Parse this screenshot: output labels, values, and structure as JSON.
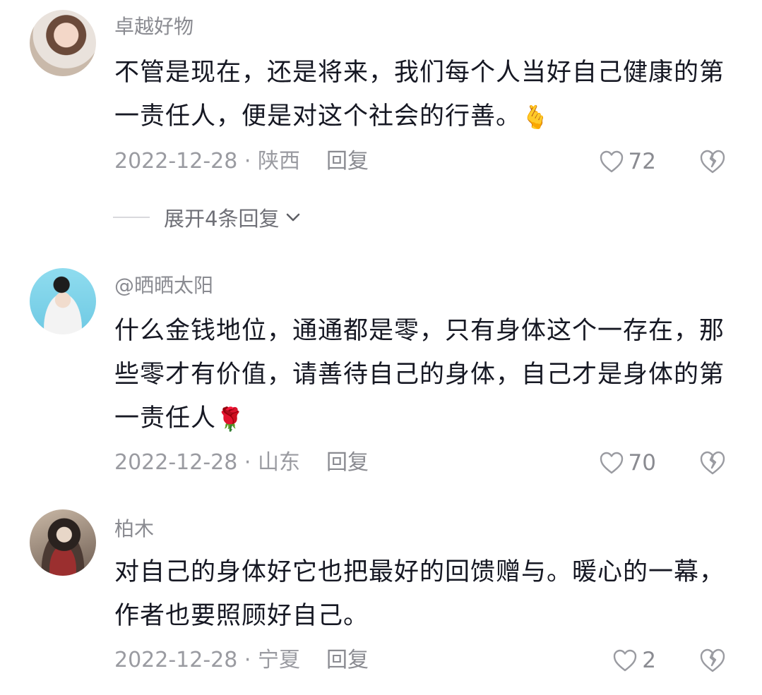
{
  "comments": [
    {
      "username": "卓越好物",
      "text": "不管是现在，还是将来，我们每个人当好自己健康的第一责任人，便是对这个社会的行善。",
      "emoji": "🫰",
      "date_location": "2022-12-28 · 陕西",
      "reply_label": "回复",
      "likes": "72",
      "expand_label": "展开4条回复"
    },
    {
      "username": "@晒晒太阳",
      "text": "什么金钱地位，通通都是零，只有身体这个一存在，那些零才有价值，请善待自己的身体，自己才是身体的第一责任人",
      "emoji": "🌹",
      "date_location": "2022-12-28 · 山东",
      "reply_label": "回复",
      "likes": "70"
    },
    {
      "username": "柏木",
      "text": "对自己的身体好它也把最好的回馈赠与。暖心的一幕，作者也要照顾好自己。",
      "date_location": "2022-12-28 · 宁夏",
      "reply_label": "回复",
      "likes": "2"
    }
  ],
  "icons": {
    "like": "heart-outline-icon",
    "dislike": "broken-heart-outline-icon",
    "expand": "chevron-down-icon"
  }
}
